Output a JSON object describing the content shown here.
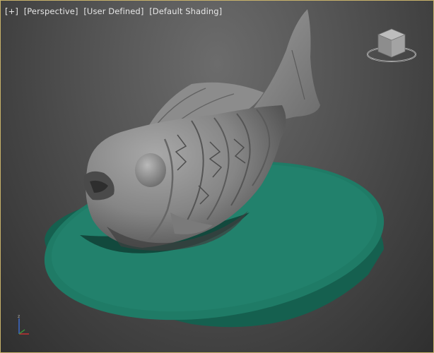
{
  "viewport": {
    "labels": [
      "[+]",
      "[Perspective]",
      "[User Defined]",
      "[Default Shading]"
    ]
  },
  "colors": {
    "model": "#7f7f7f",
    "base": "#1e7a66",
    "border": "#c8b26a"
  },
  "icons": {
    "viewcube": "viewcube-icon",
    "axis": "axis-tripod-icon"
  }
}
